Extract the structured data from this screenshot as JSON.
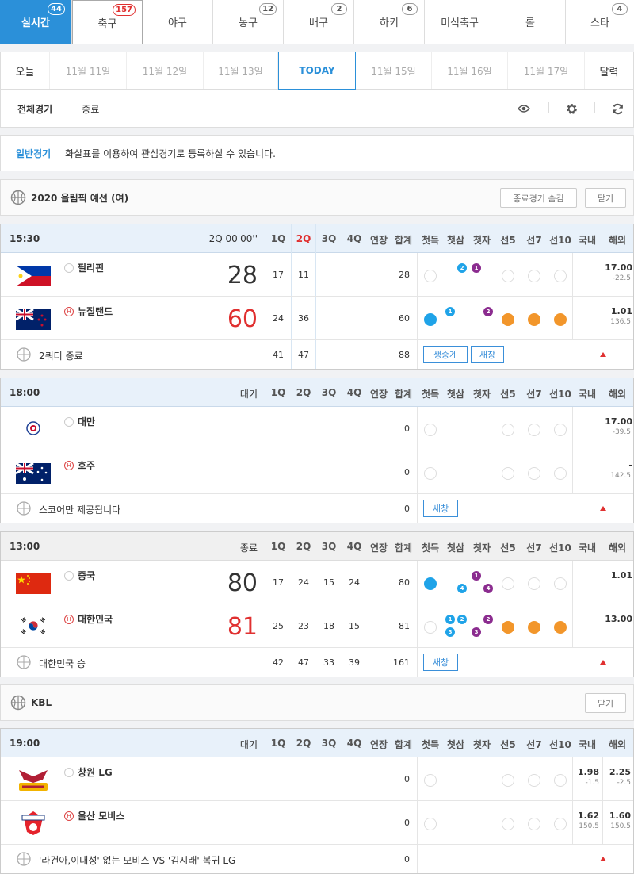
{
  "tabs": [
    {
      "label": "실시간",
      "badge": "44"
    },
    {
      "label": "축구",
      "badge": "157"
    },
    {
      "label": "야구",
      "badge": ""
    },
    {
      "label": "농구",
      "badge": "12"
    },
    {
      "label": "배구",
      "badge": "2"
    },
    {
      "label": "하키",
      "badge": "6"
    },
    {
      "label": "미식축구",
      "badge": ""
    },
    {
      "label": "롤",
      "badge": ""
    },
    {
      "label": "스타",
      "badge": "4"
    }
  ],
  "dates": [
    "오늘",
    "11월 11일",
    "11월 12일",
    "11월 13일",
    "TODAY",
    "11월 15일",
    "11월 16일",
    "11월 17일",
    "달력"
  ],
  "filter": {
    "all": "전체경기",
    "ended": "종료"
  },
  "notice": {
    "title": "일반경기",
    "message": "화살표를 이용하여 관심경기로 등록하실 수 있습니다."
  },
  "col_headers": [
    "1Q",
    "2Q",
    "3Q",
    "4Q",
    "연장",
    "합계",
    "첫득",
    "첫삼",
    "첫자",
    "선5",
    "선7",
    "선10",
    "국내",
    "해외"
  ],
  "league1": {
    "name": "2020 올림픽 예선 (여)",
    "hide_btn": "종료경기 숨김",
    "close_btn": "닫기"
  },
  "league2": {
    "name": "KBL",
    "close_btn": "닫기"
  },
  "games": [
    {
      "time": "15:30",
      "status": "2Q 00'00''",
      "home": {
        "name": "필리핀",
        "score": "28",
        "q": [
          "17",
          "11",
          "",
          ""
        ],
        "total": "28",
        "odd": "17.00",
        "odd2": "-22.5"
      },
      "away": {
        "name": "뉴질랜드",
        "score": "60",
        "q": [
          "24",
          "36",
          "",
          ""
        ],
        "total": "60",
        "odd": "1.01",
        "odd2": "136.5"
      },
      "footer": {
        "msg": "2쿼터 종료",
        "q": [
          "41",
          "47",
          "",
          ""
        ],
        "total": "88",
        "btn1": "생중계",
        "btn2": "새창"
      }
    },
    {
      "time": "18:00",
      "status": "대기",
      "home": {
        "name": "대만",
        "score": "",
        "q": [
          "",
          "",
          "",
          ""
        ],
        "total": "0",
        "odd": "17.00",
        "odd2": "-39.5"
      },
      "away": {
        "name": "호주",
        "score": "",
        "q": [
          "",
          "",
          "",
          ""
        ],
        "total": "0",
        "odd": "-",
        "odd2": "142.5"
      },
      "footer": {
        "msg": "스코어만 제공됩니다",
        "q": [
          "",
          "",
          "",
          ""
        ],
        "total": "0",
        "btn1": "새창"
      }
    },
    {
      "time": "13:00",
      "status": "종료",
      "home": {
        "name": "중국",
        "score": "80",
        "q": [
          "17",
          "24",
          "15",
          "24"
        ],
        "total": "80",
        "odd": "1.01",
        "odd2": ""
      },
      "away": {
        "name": "대한민국",
        "score": "81",
        "q": [
          "25",
          "23",
          "18",
          "15"
        ],
        "total": "81",
        "odd": "13.00",
        "odd2": ""
      },
      "footer": {
        "msg": "대한민국 승",
        "q": [
          "42",
          "47",
          "33",
          "39"
        ],
        "total": "161",
        "btn1": "새창"
      }
    },
    {
      "time": "19:00",
      "status": "대기",
      "home": {
        "name": "창원 LG",
        "score": "",
        "total": "0",
        "dom": "1.98",
        "dom2": "-1.5",
        "odd": "2.25",
        "odd2": "-2.5"
      },
      "away": {
        "name": "울산 모비스",
        "score": "",
        "total": "0",
        "dom": "1.62",
        "dom2": "150.5",
        "odd": "1.60",
        "odd2": "150.5"
      },
      "footer": {
        "msg": "'라건아,이대성' 없는 모비스 VS '김시래' 복귀 LG",
        "total": "0"
      }
    }
  ],
  "marker_labels": {
    "home": "H"
  },
  "colors": {
    "accent": "#2b90d9",
    "red": "#e03030",
    "orange": "#f2962b",
    "blue": "#1fa3e8",
    "purple": "#8b2c8f"
  },
  "icons": [
    "eye-icon",
    "gear-icon",
    "refresh-icon",
    "basketball-icon"
  ]
}
